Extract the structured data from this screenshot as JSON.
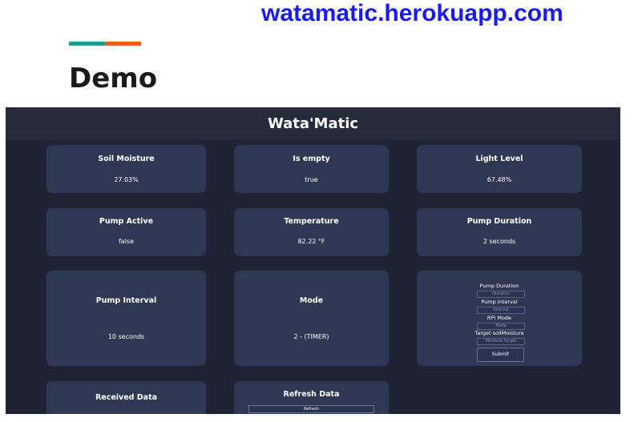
{
  "page": {
    "site_url": "watamatic.herokuapp.com",
    "section_title": "Demo"
  },
  "app": {
    "title": "Wata'Matic",
    "cards": {
      "soil_moisture": {
        "label": "Soil Moisture",
        "value": "27.03%"
      },
      "is_empty": {
        "label": "Is empty",
        "value": "true"
      },
      "light_level": {
        "label": "Light Level",
        "value": "67.48%"
      },
      "pump_active": {
        "label": "Pump Active",
        "value": "false"
      },
      "temperature": {
        "label": "Temperature",
        "value": "82.22 °F"
      },
      "pump_duration": {
        "label": "Pump Duration",
        "value": "2 seconds"
      },
      "pump_interval": {
        "label": "Pump Interval",
        "value": "10 seconds"
      },
      "mode": {
        "label": "Mode",
        "value": "2 - (TIMER)"
      },
      "received_data": {
        "label": "Received Data"
      },
      "refresh_data": {
        "label": "Refresh Data",
        "button": "Refresh"
      }
    },
    "form": {
      "duration_label": "Pump Duration",
      "duration_placeholder": "Duration",
      "interval_label": "Pump Interval",
      "interval_placeholder": "Interval",
      "mode_label": "RPI Mode",
      "mode_placeholder": "Mode",
      "target_label": "Target soilMoisture",
      "target_placeholder": "Moisture target",
      "submit": "Submit"
    }
  },
  "colors": {
    "url_blue": "#1a1aff",
    "accent_teal": "#1f9c91",
    "accent_orange": "#e8601c",
    "app_bg": "#1f2333",
    "card_bg": "#2e3853"
  }
}
